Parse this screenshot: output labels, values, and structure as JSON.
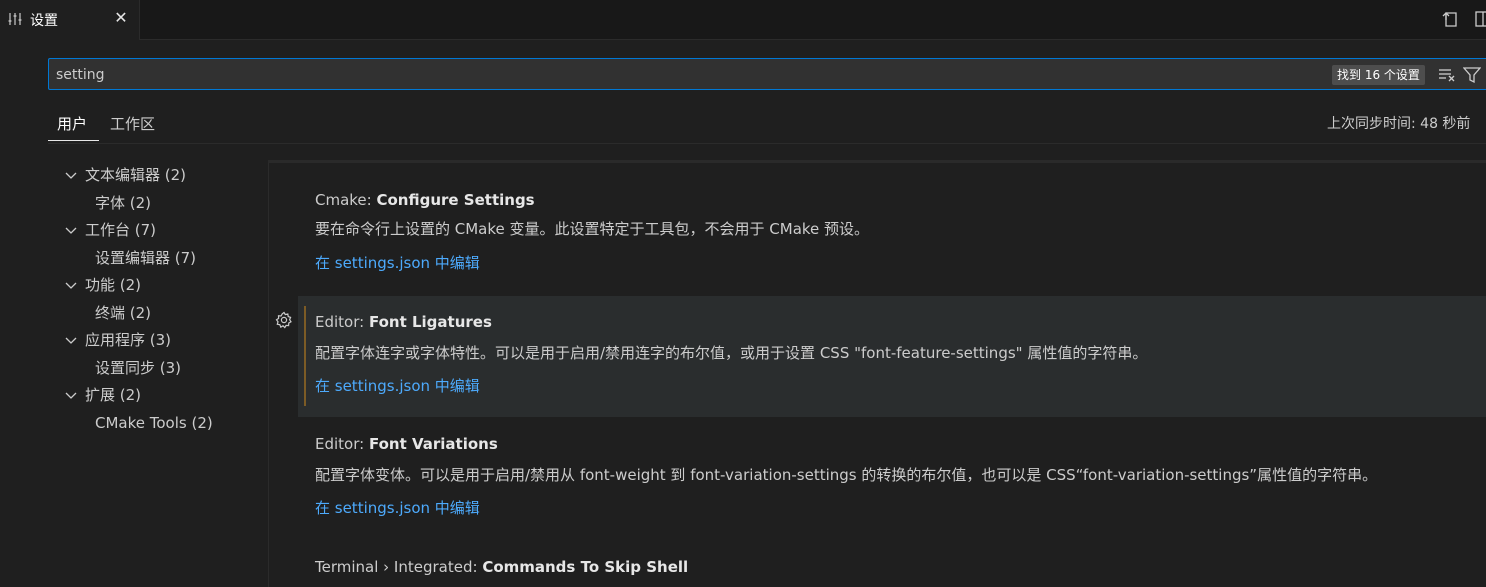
{
  "tab": {
    "title": "设置",
    "close_symbol": "✕"
  },
  "search": {
    "value": "setting",
    "result_count": "找到 16 个设置"
  },
  "scope_tabs": {
    "user": "用户",
    "workspace": "工作区"
  },
  "sync_status": "上次同步时间: 48 秒前",
  "toc": [
    {
      "label": "文本编辑器 (2)",
      "expanded": true
    },
    {
      "label": "字体 (2)"
    },
    {
      "label": "工作台 (7)",
      "expanded": true
    },
    {
      "label": "设置编辑器 (7)"
    },
    {
      "label": "功能 (2)",
      "expanded": true
    },
    {
      "label": "终端 (2)"
    },
    {
      "label": "应用程序 (3)",
      "expanded": true
    },
    {
      "label": "设置同步 (3)"
    },
    {
      "label": "扩展 (2)",
      "expanded": true
    },
    {
      "label": "CMake Tools (2)"
    }
  ],
  "settings": [
    {
      "category": "Cmake: ",
      "key": "Configure Settings",
      "description": "要在命令行上设置的 CMake 变量。此设置特定于工具包，不会用于 CMake 预设。",
      "link": "在 settings.json 中编辑"
    },
    {
      "category": "Editor: ",
      "key": "Font Ligatures",
      "description": "配置字体连字或字体特性。可以是用于启用/禁用连字的布尔值，或用于设置 CSS \"font-feature-settings\" 属性值的字符串。",
      "link": "在 settings.json 中编辑"
    },
    {
      "category": "Editor: ",
      "key": "Font Variations",
      "description": "配置字体变体。可以是用于启用/禁用从 font-weight 到 font-variation-settings 的转换的布尔值，也可以是 CSS“font-variation-settings”属性值的字符串。",
      "link": "在 settings.json 中编辑"
    },
    {
      "category": "Terminal › Integrated: ",
      "key": "Commands To Skip Shell"
    }
  ],
  "colors": {
    "accent": "#0078d4",
    "link": "#4daafc",
    "modified_indicator": "#7c5b25",
    "focused_row": "#2a2d2e"
  },
  "icons": {
    "tab": "settings-sliders-icon",
    "open-json": "open-settings-json-icon",
    "split": "split-editor-icon",
    "clear": "clear-filter-icon",
    "filter": "filter-icon",
    "gear": "gear-icon",
    "chevron": "chevron-down-icon"
  }
}
